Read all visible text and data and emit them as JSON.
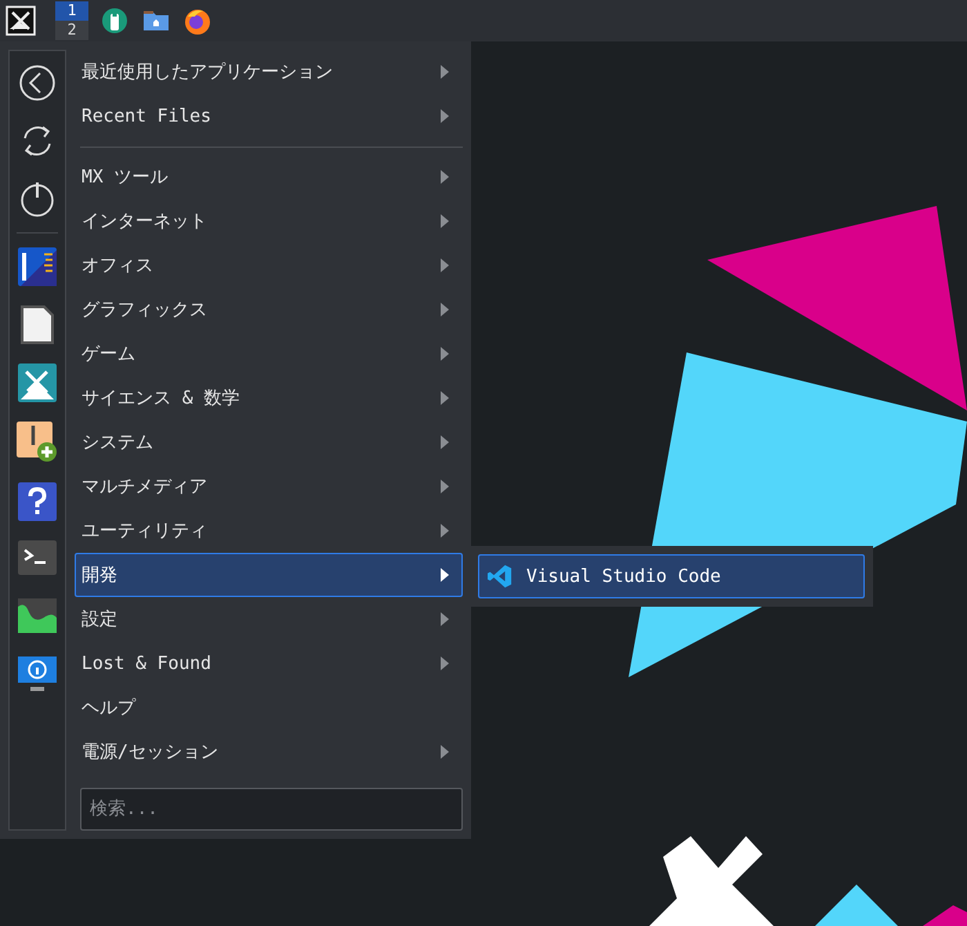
{
  "taskbar": {
    "workspaces": [
      {
        "label": "1",
        "selected": true
      },
      {
        "label": "2",
        "selected": false
      }
    ]
  },
  "menu": {
    "items": [
      {
        "label": "最近使用したアプリケーション",
        "has_submenu": true,
        "selected": false
      },
      {
        "label": "Recent Files",
        "has_submenu": true,
        "selected": false
      },
      {
        "kind": "separator"
      },
      {
        "label": "MX ツール",
        "has_submenu": true,
        "selected": false
      },
      {
        "label": "インターネット",
        "has_submenu": true,
        "selected": false
      },
      {
        "label": "オフィス",
        "has_submenu": true,
        "selected": false
      },
      {
        "label": "グラフィックス",
        "has_submenu": true,
        "selected": false
      },
      {
        "label": "ゲーム",
        "has_submenu": true,
        "selected": false
      },
      {
        "label": "サイエンス & 数学",
        "has_submenu": true,
        "selected": false
      },
      {
        "label": "システム",
        "has_submenu": true,
        "selected": false
      },
      {
        "label": "マルチメディア",
        "has_submenu": true,
        "selected": false
      },
      {
        "label": "ユーティリティ",
        "has_submenu": true,
        "selected": false
      },
      {
        "label": "開発",
        "has_submenu": true,
        "selected": true
      },
      {
        "label": "設定",
        "has_submenu": true,
        "selected": false
      },
      {
        "label": "Lost & Found",
        "has_submenu": true,
        "selected": false
      },
      {
        "label": "ヘルプ",
        "has_submenu": false,
        "selected": false
      },
      {
        "label": "電源/セッション",
        "has_submenu": true,
        "selected": false
      }
    ],
    "search": {
      "placeholder": "検索..."
    }
  },
  "submenu": {
    "items": [
      {
        "label": "Visual Studio Code",
        "selected": true
      }
    ]
  }
}
